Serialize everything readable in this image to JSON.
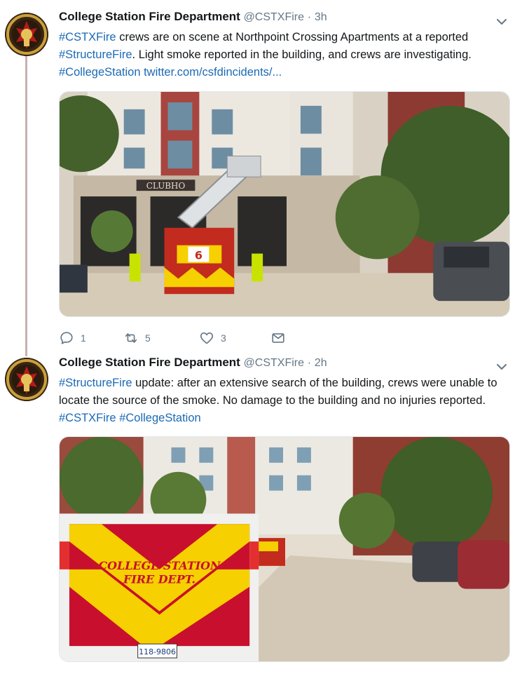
{
  "tweets": [
    {
      "author": "College Station Fire Department",
      "handle": "@CSTXFire",
      "separator": "·",
      "time": "3h",
      "text": {
        "tag1": "#CSTXFire",
        "p1": " crews are on scene at Northpoint Crossing Apartments at a reported ",
        "tag2": "#StructureFire",
        "p2": ". Light smoke reported in the building, and crews are investigating. ",
        "tag3": "#CollegeStation",
        "link": "twitter.com/csfdincidents/..."
      },
      "image_text": {
        "sign": "CLUBHO",
        "truck_number": "6"
      },
      "actions": {
        "replies": "1",
        "retweets": "5",
        "likes": "3"
      }
    },
    {
      "author": "College Station Fire Department",
      "handle": "@CSTXFire",
      "separator": "·",
      "time": "2h",
      "text": {
        "tag1": "#StructureFire",
        "p1": " update: after an extensive search of the building, crews were unable to locate the source of the smoke. No damage to the building and no injuries reported. ",
        "tag2": "#CSTXFire",
        "p2": " ",
        "tag3": "#CollegeStation"
      },
      "image_text": {
        "truck_line1": "COLLEGE STATION",
        "truck_line2": "FIRE DEPT.",
        "plate": "118-9806"
      }
    }
  ],
  "icons": {
    "avatar": "fire-department-logo",
    "caret": "chevron-down-icon",
    "reply": "reply-icon",
    "retweet": "retweet-icon",
    "like": "heart-icon",
    "dm": "envelope-icon"
  },
  "colors": {
    "link": "#1b6ab5",
    "muted": "#657786",
    "thread_line": "#ccaeb1",
    "chevron_red": "#c8102e",
    "chevron_yellow": "#f6d000"
  }
}
